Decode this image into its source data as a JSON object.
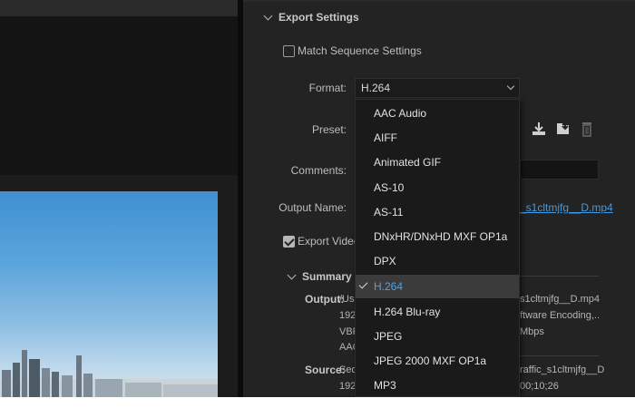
{
  "export_settings": {
    "header": "Export Settings",
    "match_sequence_label": "Match Sequence Settings",
    "match_sequence_checked": false,
    "format_label": "Format:",
    "format_value": "H.264",
    "preset_label": "Preset:",
    "comments_label": "Comments:",
    "output_name_label": "Output Name:",
    "output_name_value": "_s1cltmjfg__D.mp4",
    "export_video_label": "Export Video",
    "export_video_checked": true,
    "summary_header": "Summary",
    "summary": {
      "output_label": "Output:",
      "output_lines_left": [
        "/Us",
        "192",
        "VBF",
        "AAC"
      ],
      "output_lines_right": [
        "s1cltmjfg__D.mp4",
        "ftware Encoding,..",
        "Mbps"
      ],
      "source_label": "Source:",
      "source_lines_left": [
        "Seq",
        "192"
      ],
      "source_lines_right": [
        "raffic_s1cltmjfg__D",
        "00;10;26"
      ]
    }
  },
  "preset_icons": [
    "save-preset-icon",
    "import-preset-icon",
    "delete-preset-icon"
  ],
  "format_menu": {
    "items": [
      {
        "label": "AAC Audio",
        "selected": false
      },
      {
        "label": "AIFF",
        "selected": false
      },
      {
        "label": "Animated GIF",
        "selected": false
      },
      {
        "label": "AS-10",
        "selected": false
      },
      {
        "label": "AS-11",
        "selected": false
      },
      {
        "label": "DNxHR/DNxHD MXF OP1a",
        "selected": false
      },
      {
        "label": "DPX",
        "selected": false
      },
      {
        "label": "H.264",
        "selected": true
      },
      {
        "label": "H.264 Blu-ray",
        "selected": false
      },
      {
        "label": "JPEG",
        "selected": false
      },
      {
        "label": "JPEG 2000 MXF OP1a",
        "selected": false
      },
      {
        "label": "MP3",
        "selected": false
      }
    ]
  },
  "colors": {
    "accent_blue": "#3d9ae8",
    "panel_bg": "#232323",
    "menu_bg": "#1a1a1a",
    "menu_selected_bg": "#3b3b3b"
  }
}
